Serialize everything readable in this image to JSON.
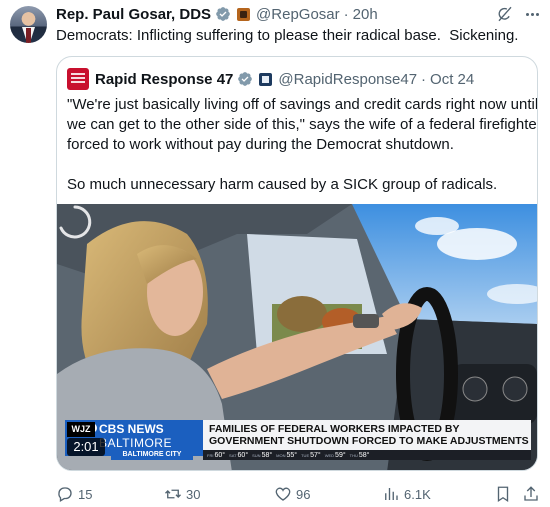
{
  "post": {
    "author_name": "Rep. Paul Gosar, DDS",
    "handle": "@RepGosar",
    "separator": "·",
    "time": "20h",
    "text": "Democrats: Inflicting suffering to please their radical base.  Sickening."
  },
  "quoted_post": {
    "author_name": "Rapid Response 47",
    "handle": "@RapidResponse47",
    "separator": "·",
    "time": "Oct 24",
    "text": "\"We're just basically living off of savings and credit cards right now until\nwe can get to the other side of this,\" says the wife of a federal firefighter\nforced to work without pay during the Democrat shutdown.\n\nSo much unnecessary harm caused by a SICK group of radicals.",
    "video": {
      "station": "WJZ",
      "duration": "2:01",
      "network_line1": "CBS NEWS",
      "network_line2": "BALTIMORE",
      "city": "BALTIMORE CITY",
      "headline_line1": "FAMILIES OF FEDERAL WORKERS IMPACTED BY",
      "headline_line2": "GOVERNMENT SHUTDOWN FORCED TO MAKE ADJUSTMENTS",
      "weather": [
        {
          "day": "FRI",
          "temp": "60°"
        },
        {
          "day": "SAT",
          "temp": "60°"
        },
        {
          "day": "SUN",
          "temp": "58°"
        },
        {
          "day": "MON",
          "temp": "55°"
        },
        {
          "day": "TUE",
          "temp": "57°"
        },
        {
          "day": "WED",
          "temp": "59°"
        },
        {
          "day": "THU",
          "temp": "58°"
        }
      ]
    }
  },
  "actions": {
    "replies": "15",
    "reposts": "30",
    "likes": "96",
    "views": "6.1K"
  },
  "colors": {
    "verified": "#1d9bf0",
    "text_secondary": "#536471",
    "border": "#cfd9de",
    "cbs_blue": "#1b5fbf"
  },
  "icons": [
    "grok-icon",
    "more-icon",
    "verified-icon",
    "reply-icon",
    "repost-icon",
    "like-icon",
    "views-icon",
    "bookmark-icon",
    "share-icon"
  ]
}
